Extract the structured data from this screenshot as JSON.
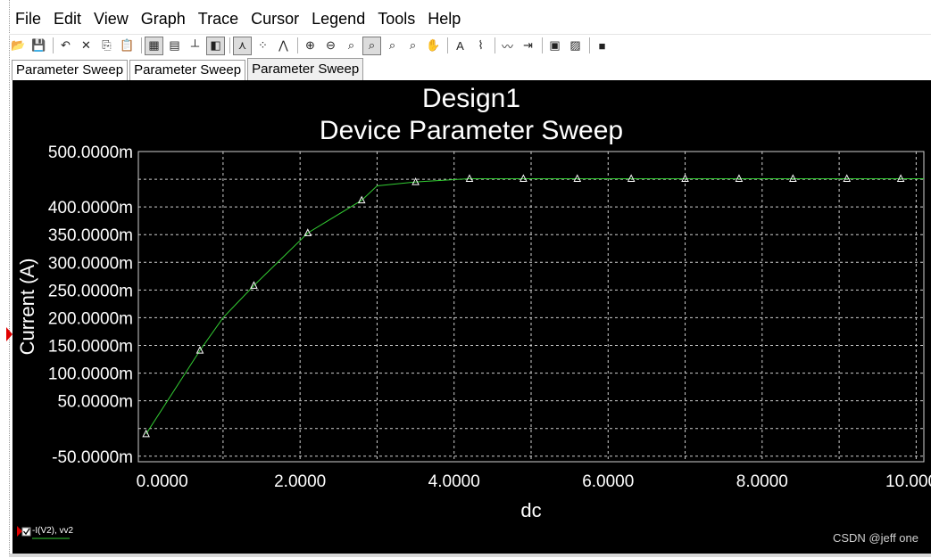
{
  "menu": [
    "File",
    "Edit",
    "View",
    "Graph",
    "Trace",
    "Cursor",
    "Legend",
    "Tools",
    "Help"
  ],
  "toolbar": [
    {
      "name": "open-icon",
      "glyph": "📂"
    },
    {
      "name": "save-icon",
      "glyph": "💾"
    },
    {
      "sep": true
    },
    {
      "name": "undo-icon",
      "glyph": "↶"
    },
    {
      "name": "delete-icon",
      "glyph": "✕"
    },
    {
      "name": "copy-icon",
      "glyph": "⎘"
    },
    {
      "name": "paste-icon",
      "glyph": "📋"
    },
    {
      "sep": true
    },
    {
      "name": "grid-icon",
      "glyph": "▦",
      "pressed": true
    },
    {
      "name": "fine-grid-icon",
      "glyph": "▤"
    },
    {
      "name": "axis-icon",
      "glyph": "┴"
    },
    {
      "name": "black-white-icon",
      "glyph": "◧",
      "pressed": true
    },
    {
      "sep": true
    },
    {
      "name": "show-lines-icon",
      "glyph": "⋏",
      "pressed": true
    },
    {
      "name": "show-points-icon",
      "glyph": "⁘"
    },
    {
      "name": "lines-points-icon",
      "glyph": "⋀"
    },
    {
      "sep": true
    },
    {
      "name": "zoom-in-icon",
      "glyph": "⊕"
    },
    {
      "name": "zoom-out-icon",
      "glyph": "⊖"
    },
    {
      "name": "zoom-area-icon",
      "glyph": "⌕"
    },
    {
      "name": "zoom-full-icon",
      "glyph": "⌕",
      "pressed": true
    },
    {
      "name": "zoom-x-icon",
      "glyph": "⌕"
    },
    {
      "name": "zoom-y-icon",
      "glyph": "⌕"
    },
    {
      "name": "pan-icon",
      "glyph": "✋"
    },
    {
      "sep": true
    },
    {
      "name": "text-icon",
      "glyph": "A"
    },
    {
      "name": "label-icon",
      "glyph": "⌇"
    },
    {
      "sep": true
    },
    {
      "name": "add-trace-icon",
      "glyph": "〰"
    },
    {
      "name": "export-icon",
      "glyph": "⇥"
    },
    {
      "sep": true
    },
    {
      "name": "properties-icon",
      "glyph": "▣"
    },
    {
      "name": "overlay-icon",
      "glyph": "▨"
    },
    {
      "sep": true
    },
    {
      "name": "stop-icon",
      "glyph": "■"
    }
  ],
  "tabs": [
    {
      "label": "Parameter Sweep",
      "active": false
    },
    {
      "label": "Parameter Sweep",
      "active": false
    },
    {
      "label": "Parameter Sweep",
      "active": true
    }
  ],
  "chart_data": {
    "type": "line",
    "title": "Design1",
    "subtitle": "Device Parameter Sweep",
    "xlabel": "dc",
    "ylabel": "Current (A)",
    "xlim": [
      -0.1,
      10.1
    ],
    "ylim": [
      -60,
      500
    ],
    "x_ticks": [
      0,
      2,
      4,
      6,
      8,
      10
    ],
    "x_tick_labels": [
      "0.0000",
      "2.0000",
      "4.0000",
      "6.0000",
      "8.0000",
      "10.0000"
    ],
    "y_ticks": [
      500,
      400,
      350,
      300,
      250,
      200,
      150,
      100,
      50,
      -50
    ],
    "y_tick_labels": [
      "500.0000m",
      "400.0000m",
      "350.0000m",
      "300.0000m",
      "250.0000m",
      "200.0000m",
      "150.0000m",
      "100.0000m",
      "50.0000m",
      "-50.0000m"
    ],
    "grid": true,
    "series": [
      {
        "name": "-I(V2), vv2",
        "color": "#33cc33",
        "x": [
          0,
          0.7,
          1.0,
          1.4,
          2.1,
          2.8,
          3.0,
          3.5,
          4.2,
          4.9,
          5.6,
          6.3,
          7.0,
          7.7,
          8.4,
          9.1,
          9.8,
          10.1
        ],
        "y": [
          -10,
          141,
          200,
          258,
          353,
          412,
          438,
          445,
          451,
          451,
          451,
          451,
          451,
          451,
          451,
          451,
          451,
          451
        ],
        "markers_at": [
          0,
          0.7,
          1.4,
          2.1,
          2.8,
          3.5,
          4.2,
          4.9,
          5.6,
          6.3,
          7.0,
          7.7,
          8.4,
          9.1,
          9.8
        ]
      }
    ],
    "legend_position": "bottom-left"
  },
  "watermark": "CSDN @jeff one",
  "colors": {
    "background": "#000000",
    "grid": "#cfcfcf",
    "text": "#ffffff",
    "trace": "#33cc33"
  }
}
